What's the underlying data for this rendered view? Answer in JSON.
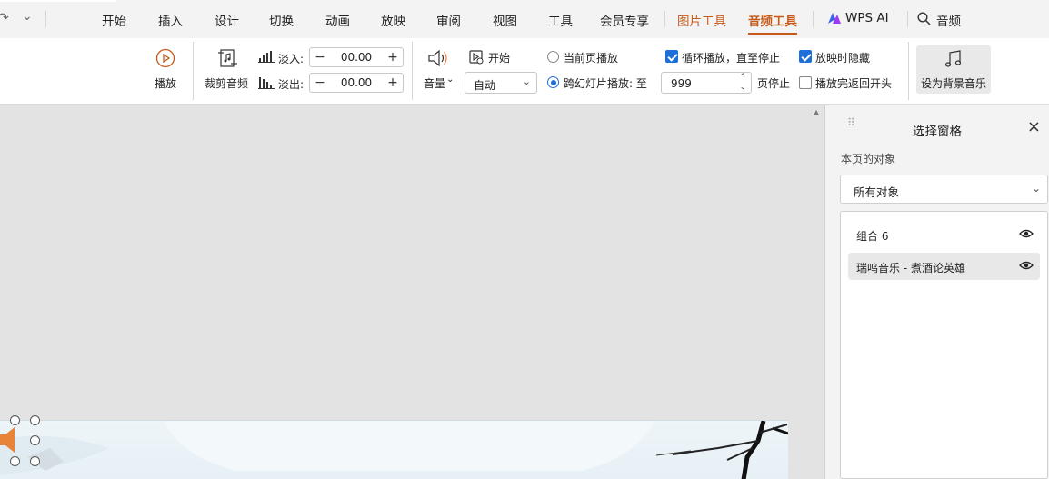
{
  "menubar": {
    "quick_redo": "↷",
    "quick_more": "⌄",
    "tabs": [
      "开始",
      "插入",
      "设计",
      "切换",
      "动画",
      "放映",
      "审阅",
      "视图",
      "工具",
      "会员专享"
    ],
    "context_tabs": [
      "图片工具",
      "音频工具"
    ],
    "active_tab": "音频工具",
    "wps_ai": "WPS AI",
    "search_label": "音频"
  },
  "ribbon": {
    "play_label": "播放",
    "trim_label": "裁剪音频",
    "fade_in_label": "淡入:",
    "fade_in_value": "00.00",
    "fade_out_label": "淡出:",
    "fade_out_value": "00.00",
    "minus": "−",
    "plus": "+",
    "volume_label": "音量",
    "start_label": "开始",
    "start_value": "自动",
    "radio_current": "当前页播放",
    "radio_cross": "跨幻灯片播放: 至",
    "cross_pages_value": "999",
    "page_stop_label": "页停止",
    "loop_label": "循环播放，直至停止",
    "rewind_label": "播放完返回开头",
    "hide_label": "放映时隐藏",
    "bg_music_label": "设为背景音乐",
    "checks": {
      "loop": true,
      "hide": true,
      "rewind": false
    },
    "radio_selected": "cross"
  },
  "pane": {
    "title": "选择窗格",
    "close": "×",
    "subtitle": "本页的对象",
    "filter_value": "所有对象",
    "objects": [
      {
        "name": "组合 6",
        "visible": true,
        "selected": false
      },
      {
        "name": "瑞鸣音乐 - 煮酒论英雄",
        "visible": true,
        "selected": true
      }
    ]
  },
  "colors": {
    "accent": "#c55a1b",
    "check_blue": "#1e6fd9",
    "audio_icon": "#e8833a"
  }
}
